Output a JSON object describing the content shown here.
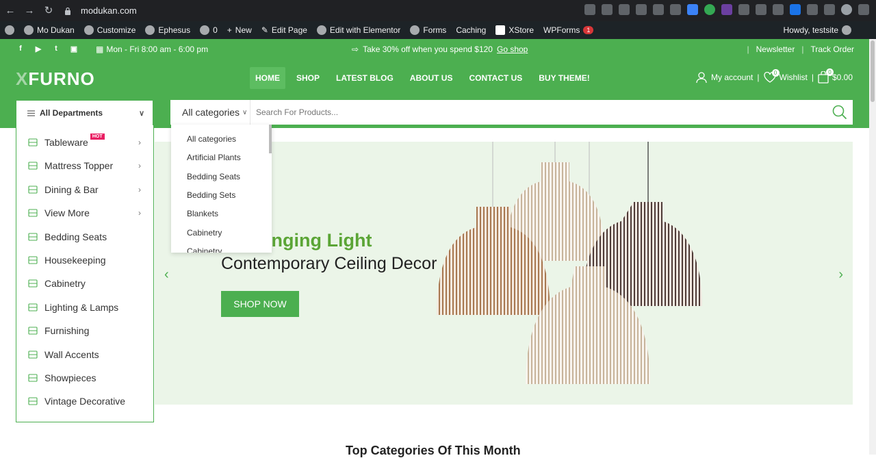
{
  "browser": {
    "url": "modukan.com"
  },
  "wp_admin": {
    "site": "Mo Dukan",
    "customize": "Customize",
    "theme": "Ephesus",
    "comments": "0",
    "new": "New",
    "edit_page": "Edit Page",
    "elementor": "Edit with Elementor",
    "forms": "Forms",
    "caching": "Caching",
    "xstore": "XStore",
    "wpforms": "WPForms",
    "wpforms_badge": "1",
    "howdy": "Howdy, testsite"
  },
  "topbar": {
    "hours": "Mon - Fri 8:00 am - 6:00 pm",
    "promo": "Take 30% off when you spend $120",
    "promo_link": "Go shop",
    "newsletter": "Newsletter",
    "track": "Track Order"
  },
  "header": {
    "logo_x": "X",
    "logo_rest": "FURNO",
    "nav": [
      "HOME",
      "SHOP",
      "LATEST BLOG",
      "ABOUT US",
      "CONTACT US",
      "BUY THEME!"
    ],
    "account": "My account",
    "wishlist": "Wishlist",
    "wishlist_count": "0",
    "cart_count": "0",
    "cart_total": "$0.00"
  },
  "search": {
    "departments": "All Departments",
    "category": "All categories",
    "placeholder": "Search For Products..."
  },
  "categories": [
    {
      "label": "Tableware",
      "hot": "HOT",
      "arrow": true
    },
    {
      "label": "Mattress Topper",
      "arrow": true
    },
    {
      "label": "Dining & Bar",
      "arrow": true
    },
    {
      "label": "View More",
      "arrow": true
    },
    {
      "label": "Bedding Seats"
    },
    {
      "label": "Housekeeping"
    },
    {
      "label": "Cabinetry"
    },
    {
      "label": "Lighting & Lamps"
    },
    {
      "label": "Furnishing"
    },
    {
      "label": "Wall Accents"
    },
    {
      "label": "Showpieces"
    },
    {
      "label": "Vintage Decorative"
    }
  ],
  "dropdown": [
    "All categories",
    "Artificial Plants",
    "Bedding Seats",
    "Bedding Sets",
    "Blankets",
    "Cabinetry",
    "Cabinetry"
  ],
  "hero": {
    "title": "na Hanging Light",
    "subtitle": "Contemporary Ceiling Decor",
    "button": "SHOP NOW"
  },
  "section_title": "Top Categories Of This Month",
  "colors": {
    "brand": "#4caf50",
    "hot": "#e91e63",
    "hero_bg": "#ebf5e8"
  }
}
